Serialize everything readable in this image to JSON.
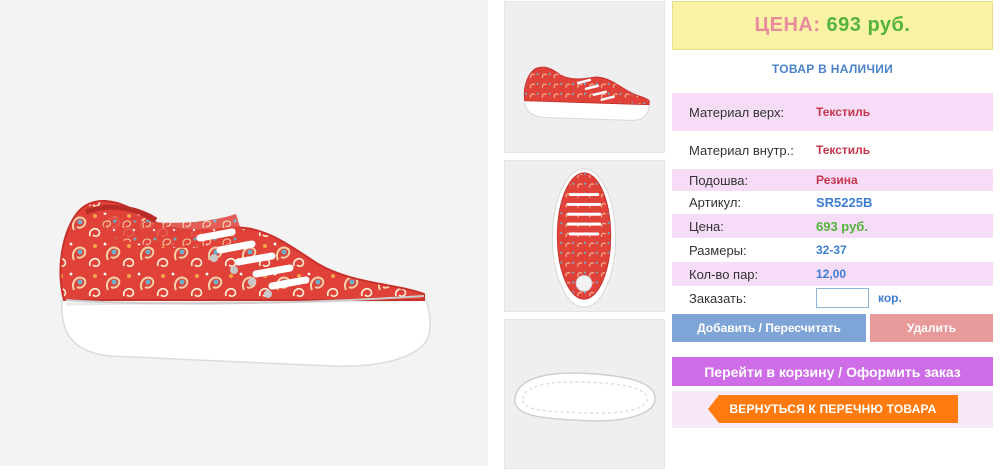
{
  "product": {
    "images": [
      {
        "name": "main-photo",
        "alt": "paisley-sneaker-side"
      },
      {
        "name": "thumb-side",
        "alt": "paisley-sneaker-side"
      },
      {
        "name": "thumb-top",
        "alt": "paisley-sneaker-top"
      },
      {
        "name": "thumb-sole",
        "alt": "paisley-sneaker-sole"
      }
    ],
    "colors": {
      "primary": "#e0423a",
      "paisley_accent": "#f0c8a0",
      "sole": "#ffffff"
    }
  },
  "price_banner": {
    "label": "ЦЕНА:",
    "value": "693 руб."
  },
  "stock_status": "ТОВАР В НАЛИЧИИ",
  "specs": {
    "upper_material": {
      "label": "Материал верх:",
      "value": "Текстиль"
    },
    "inner_material": {
      "label": "Материал внутр.:",
      "value": "Текстиль"
    },
    "sole": {
      "label": "Подошва:",
      "value": "Резина"
    },
    "article": {
      "label": "Артикул:",
      "value": "SR5225B"
    },
    "price": {
      "label": "Цена:",
      "value": "693 руб."
    },
    "sizes": {
      "label": "Размеры:",
      "value": "32-37"
    },
    "pairs": {
      "label": "Кол-во пар:",
      "value": "12,00"
    }
  },
  "order": {
    "label": "Заказать:",
    "value": "",
    "unit": "кор."
  },
  "buttons": {
    "update": "Добавить / Пересчитать",
    "delete": "Удалить",
    "cart": "Перейти в корзину / Оформить заказ",
    "back": "ВЕРНУТЬСЯ К ПЕРЕЧНЮ ТОВАРА"
  }
}
